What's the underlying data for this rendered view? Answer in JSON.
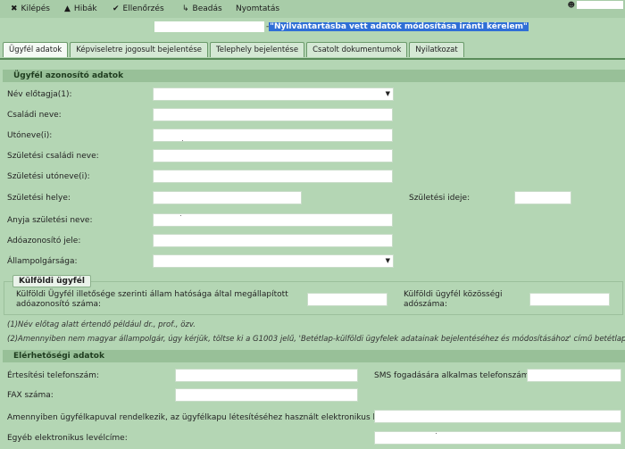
{
  "toolbar": {
    "items": [
      {
        "icon": "x-icon",
        "glyph": "✖",
        "label": "Kilépés"
      },
      {
        "icon": "warning-icon",
        "glyph": "▲",
        "label": "Hibák"
      },
      {
        "icon": "check-icon",
        "glyph": "✔",
        "label": "Ellenőrzés"
      },
      {
        "icon": "submit-arrow-icon",
        "glyph": "↳",
        "label": "Beadás"
      },
      {
        "icon": "print-icon",
        "glyph": "",
        "label": "Nyomtatás"
      }
    ],
    "user_icon": "person-icon"
  },
  "title": {
    "prefix": "-",
    "highlighted": "\"Nyilvántartásba vett adatok módosítása iránti kérelem\""
  },
  "tabs": [
    {
      "label": "Ügyfél adatok",
      "active": true
    },
    {
      "label": "Képviseletre jogosult bejelentése",
      "active": false
    },
    {
      "label": "Telephely bejelentése",
      "active": false
    },
    {
      "label": "Csatolt dokumentumok",
      "active": false
    },
    {
      "label": "Nyilatkozat",
      "active": false
    }
  ],
  "client_section": {
    "title": "Ügyfél azonosító adatok",
    "fields": {
      "name_prefix": {
        "label": "Név előtagja(1):",
        "value": ""
      },
      "family_name": {
        "label": "Családi neve:",
        "value": ""
      },
      "given_names": {
        "label": "Utóneve(i):",
        "value": ""
      },
      "birth_family_name": {
        "label": "Születési családi neve:",
        "value": ""
      },
      "birth_given_names": {
        "label": "Születési utóneve(i):",
        "value": ""
      },
      "birth_place": {
        "label": "Születési helye:",
        "value": ""
      },
      "birth_date": {
        "label": "Születési ideje:",
        "value": ""
      },
      "mother_name": {
        "label": "Anyja születési neve:",
        "value": ""
      },
      "tax_id": {
        "label": "Adóazonosító jele:",
        "value": ""
      },
      "citizenship": {
        "label": "Állampolgársága:",
        "value": ""
      }
    }
  },
  "foreign_client": {
    "legend": "Külföldi ügyfél",
    "tax_authority_id_label_1": "Külföldi Ügyfél illetősége szerinti állam hatósága által megállapított",
    "tax_authority_id_label_2": "adóazonosító száma:",
    "community_tax_label_1": "Külföldi ügyfél közösségi",
    "community_tax_label_2": "adószáma:"
  },
  "notes": {
    "note1": "(1)Név előtag alatt értendő például dr., prof., özv.",
    "note2": "(2)Amennyiben nem magyar állampolgár, úgy kérjük, töltse ki a G1003 jelű, 'Betétlap-külföldi ügyfelek adatainak bejelentéséhez és módosításához' című betétlapot."
  },
  "contact_section": {
    "title": "Elérhetőségi adatok",
    "fields": {
      "phone": {
        "label": "Értesítési telefonszám:",
        "value": ""
      },
      "sms_phone": {
        "label": "SMS fogadására alkalmas telefonszám:",
        "value": ""
      },
      "fax": {
        "label": "FAX száma:",
        "value": ""
      },
      "client_gate_email": {
        "label": "Amennyiben ügyfélkapuval rendelkezik, az ügyfélkapu létesítéséhez használt elektronikus levélcíme:",
        "value": ""
      },
      "other_email": {
        "label": "Egyéb elektronikus levélcíme:",
        "value": ""
      }
    }
  },
  "colors": {
    "background": "#b4d6b4",
    "section_bar": "#98c098",
    "title_highlight": "#2f6fd6"
  }
}
